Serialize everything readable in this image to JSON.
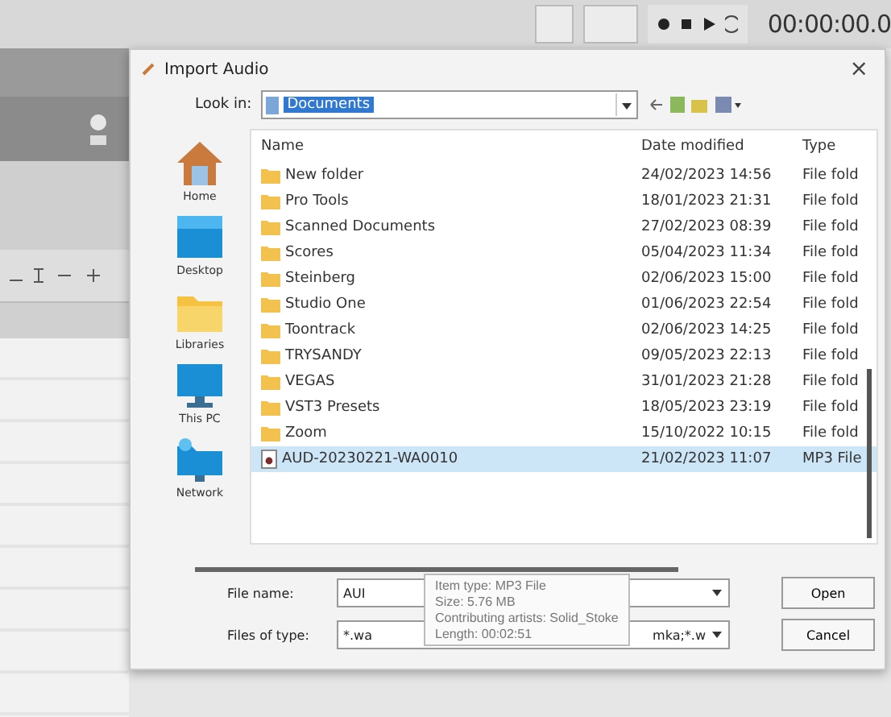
{
  "daw": {
    "timecode": "00:00:00.0"
  },
  "dialog": {
    "title": "Import Audio",
    "close": "×",
    "look_in": {
      "label": "Look in:",
      "value": "Documents"
    },
    "places": [
      {
        "label": "Home",
        "kind": "home"
      },
      {
        "label": "Desktop",
        "kind": "desktop"
      },
      {
        "label": "Libraries",
        "kind": "libraries"
      },
      {
        "label": "This PC",
        "kind": "pc"
      },
      {
        "label": "Network",
        "kind": "network"
      }
    ],
    "columns": [
      "Name",
      "Date modified",
      "Type"
    ],
    "rows": [
      {
        "name": "New folder",
        "date": "24/02/2023 14:56",
        "type": "File fold",
        "kind": "folder",
        "selected": false
      },
      {
        "name": "Pro Tools",
        "date": "18/01/2023 21:31",
        "type": "File fold",
        "kind": "folder",
        "selected": false
      },
      {
        "name": "Scanned Documents",
        "date": "27/02/2023 08:39",
        "type": "File fold",
        "kind": "folder",
        "selected": false
      },
      {
        "name": "Scores",
        "date": "05/04/2023 11:34",
        "type": "File fold",
        "kind": "folder",
        "selected": false
      },
      {
        "name": "Steinberg",
        "date": "02/06/2023 15:00",
        "type": "File fold",
        "kind": "folder",
        "selected": false
      },
      {
        "name": "Studio One",
        "date": "01/06/2023 22:54",
        "type": "File fold",
        "kind": "folder",
        "selected": false
      },
      {
        "name": "Toontrack",
        "date": "02/06/2023 14:25",
        "type": "File fold",
        "kind": "folder",
        "selected": false
      },
      {
        "name": "TRYSANDY",
        "date": "09/05/2023 22:13",
        "type": "File fold",
        "kind": "folder",
        "selected": false
      },
      {
        "name": "VEGAS",
        "date": "31/01/2023 21:28",
        "type": "File fold",
        "kind": "folder",
        "selected": false
      },
      {
        "name": "VST3 Presets",
        "date": "18/05/2023 23:19",
        "type": "File fold",
        "kind": "folder",
        "selected": false
      },
      {
        "name": "Zoom",
        "date": "15/10/2022 10:15",
        "type": "File fold",
        "kind": "folder",
        "selected": false
      },
      {
        "name": "AUD-20230221-WA0010",
        "date": "21/02/2023 11:07",
        "type": "MP3 File",
        "kind": "audio",
        "selected": true
      }
    ],
    "file_name": {
      "label": "File name:",
      "value": "AUI"
    },
    "file_type": {
      "label": "Files of type:",
      "value_start": "*.wa",
      "value_end": "mka;*.w"
    },
    "buttons": [
      "Open",
      "Cancel"
    ],
    "tooltip": [
      "Item type: MP3 File",
      "Size: 5.76 MB",
      "Contributing artists: Solid_Stoke",
      "Length: 00:02:51"
    ]
  }
}
